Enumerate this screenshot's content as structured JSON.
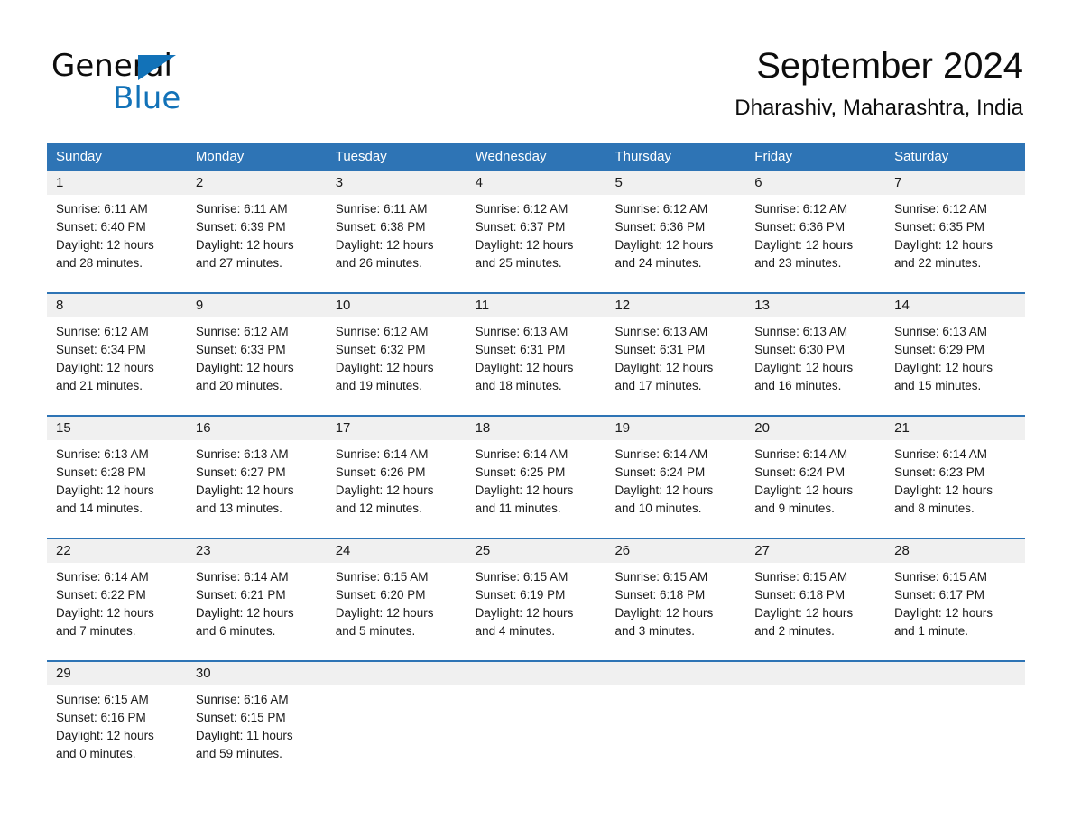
{
  "brand": {
    "name_part1": "General",
    "name_part2": "Blue",
    "triangle_icon": "triangle-logo-icon",
    "accent_color": "#1272b8"
  },
  "header": {
    "month_title": "September 2024",
    "location": "Dharashiv, Maharashtra, India"
  },
  "theme": {
    "header_blue": "#2e74b5",
    "daynum_band": "#f0f0f0",
    "text": "#1a1a1a"
  },
  "calendar": {
    "weekdays": [
      "Sunday",
      "Monday",
      "Tuesday",
      "Wednesday",
      "Thursday",
      "Friday",
      "Saturday"
    ],
    "weeks": [
      {
        "days": [
          {
            "num": "1",
            "sunrise": "Sunrise: 6:11 AM",
            "sunset": "Sunset: 6:40 PM",
            "daylight_line1": "Daylight: 12 hours",
            "daylight_line2": "and 28 minutes."
          },
          {
            "num": "2",
            "sunrise": "Sunrise: 6:11 AM",
            "sunset": "Sunset: 6:39 PM",
            "daylight_line1": "Daylight: 12 hours",
            "daylight_line2": "and 27 minutes."
          },
          {
            "num": "3",
            "sunrise": "Sunrise: 6:11 AM",
            "sunset": "Sunset: 6:38 PM",
            "daylight_line1": "Daylight: 12 hours",
            "daylight_line2": "and 26 minutes."
          },
          {
            "num": "4",
            "sunrise": "Sunrise: 6:12 AM",
            "sunset": "Sunset: 6:37 PM",
            "daylight_line1": "Daylight: 12 hours",
            "daylight_line2": "and 25 minutes."
          },
          {
            "num": "5",
            "sunrise": "Sunrise: 6:12 AM",
            "sunset": "Sunset: 6:36 PM",
            "daylight_line1": "Daylight: 12 hours",
            "daylight_line2": "and 24 minutes."
          },
          {
            "num": "6",
            "sunrise": "Sunrise: 6:12 AM",
            "sunset": "Sunset: 6:36 PM",
            "daylight_line1": "Daylight: 12 hours",
            "daylight_line2": "and 23 minutes."
          },
          {
            "num": "7",
            "sunrise": "Sunrise: 6:12 AM",
            "sunset": "Sunset: 6:35 PM",
            "daylight_line1": "Daylight: 12 hours",
            "daylight_line2": "and 22 minutes."
          }
        ]
      },
      {
        "days": [
          {
            "num": "8",
            "sunrise": "Sunrise: 6:12 AM",
            "sunset": "Sunset: 6:34 PM",
            "daylight_line1": "Daylight: 12 hours",
            "daylight_line2": "and 21 minutes."
          },
          {
            "num": "9",
            "sunrise": "Sunrise: 6:12 AM",
            "sunset": "Sunset: 6:33 PM",
            "daylight_line1": "Daylight: 12 hours",
            "daylight_line2": "and 20 minutes."
          },
          {
            "num": "10",
            "sunrise": "Sunrise: 6:12 AM",
            "sunset": "Sunset: 6:32 PM",
            "daylight_line1": "Daylight: 12 hours",
            "daylight_line2": "and 19 minutes."
          },
          {
            "num": "11",
            "sunrise": "Sunrise: 6:13 AM",
            "sunset": "Sunset: 6:31 PM",
            "daylight_line1": "Daylight: 12 hours",
            "daylight_line2": "and 18 minutes."
          },
          {
            "num": "12",
            "sunrise": "Sunrise: 6:13 AM",
            "sunset": "Sunset: 6:31 PM",
            "daylight_line1": "Daylight: 12 hours",
            "daylight_line2": "and 17 minutes."
          },
          {
            "num": "13",
            "sunrise": "Sunrise: 6:13 AM",
            "sunset": "Sunset: 6:30 PM",
            "daylight_line1": "Daylight: 12 hours",
            "daylight_line2": "and 16 minutes."
          },
          {
            "num": "14",
            "sunrise": "Sunrise: 6:13 AM",
            "sunset": "Sunset: 6:29 PM",
            "daylight_line1": "Daylight: 12 hours",
            "daylight_line2": "and 15 minutes."
          }
        ]
      },
      {
        "days": [
          {
            "num": "15",
            "sunrise": "Sunrise: 6:13 AM",
            "sunset": "Sunset: 6:28 PM",
            "daylight_line1": "Daylight: 12 hours",
            "daylight_line2": "and 14 minutes."
          },
          {
            "num": "16",
            "sunrise": "Sunrise: 6:13 AM",
            "sunset": "Sunset: 6:27 PM",
            "daylight_line1": "Daylight: 12 hours",
            "daylight_line2": "and 13 minutes."
          },
          {
            "num": "17",
            "sunrise": "Sunrise: 6:14 AM",
            "sunset": "Sunset: 6:26 PM",
            "daylight_line1": "Daylight: 12 hours",
            "daylight_line2": "and 12 minutes."
          },
          {
            "num": "18",
            "sunrise": "Sunrise: 6:14 AM",
            "sunset": "Sunset: 6:25 PM",
            "daylight_line1": "Daylight: 12 hours",
            "daylight_line2": "and 11 minutes."
          },
          {
            "num": "19",
            "sunrise": "Sunrise: 6:14 AM",
            "sunset": "Sunset: 6:24 PM",
            "daylight_line1": "Daylight: 12 hours",
            "daylight_line2": "and 10 minutes."
          },
          {
            "num": "20",
            "sunrise": "Sunrise: 6:14 AM",
            "sunset": "Sunset: 6:24 PM",
            "daylight_line1": "Daylight: 12 hours",
            "daylight_line2": "and 9 minutes."
          },
          {
            "num": "21",
            "sunrise": "Sunrise: 6:14 AM",
            "sunset": "Sunset: 6:23 PM",
            "daylight_line1": "Daylight: 12 hours",
            "daylight_line2": "and 8 minutes."
          }
        ]
      },
      {
        "days": [
          {
            "num": "22",
            "sunrise": "Sunrise: 6:14 AM",
            "sunset": "Sunset: 6:22 PM",
            "daylight_line1": "Daylight: 12 hours",
            "daylight_line2": "and 7 minutes."
          },
          {
            "num": "23",
            "sunrise": "Sunrise: 6:14 AM",
            "sunset": "Sunset: 6:21 PM",
            "daylight_line1": "Daylight: 12 hours",
            "daylight_line2": "and 6 minutes."
          },
          {
            "num": "24",
            "sunrise": "Sunrise: 6:15 AM",
            "sunset": "Sunset: 6:20 PM",
            "daylight_line1": "Daylight: 12 hours",
            "daylight_line2": "and 5 minutes."
          },
          {
            "num": "25",
            "sunrise": "Sunrise: 6:15 AM",
            "sunset": "Sunset: 6:19 PM",
            "daylight_line1": "Daylight: 12 hours",
            "daylight_line2": "and 4 minutes."
          },
          {
            "num": "26",
            "sunrise": "Sunrise: 6:15 AM",
            "sunset": "Sunset: 6:18 PM",
            "daylight_line1": "Daylight: 12 hours",
            "daylight_line2": "and 3 minutes."
          },
          {
            "num": "27",
            "sunrise": "Sunrise: 6:15 AM",
            "sunset": "Sunset: 6:18 PM",
            "daylight_line1": "Daylight: 12 hours",
            "daylight_line2": "and 2 minutes."
          },
          {
            "num": "28",
            "sunrise": "Sunrise: 6:15 AM",
            "sunset": "Sunset: 6:17 PM",
            "daylight_line1": "Daylight: 12 hours",
            "daylight_line2": "and 1 minute."
          }
        ]
      },
      {
        "days": [
          {
            "num": "29",
            "sunrise": "Sunrise: 6:15 AM",
            "sunset": "Sunset: 6:16 PM",
            "daylight_line1": "Daylight: 12 hours",
            "daylight_line2": "and 0 minutes."
          },
          {
            "num": "30",
            "sunrise": "Sunrise: 6:16 AM",
            "sunset": "Sunset: 6:15 PM",
            "daylight_line1": "Daylight: 11 hours",
            "daylight_line2": "and 59 minutes."
          },
          {
            "num": "",
            "sunrise": "",
            "sunset": "",
            "daylight_line1": "",
            "daylight_line2": ""
          },
          {
            "num": "",
            "sunrise": "",
            "sunset": "",
            "daylight_line1": "",
            "daylight_line2": ""
          },
          {
            "num": "",
            "sunrise": "",
            "sunset": "",
            "daylight_line1": "",
            "daylight_line2": ""
          },
          {
            "num": "",
            "sunrise": "",
            "sunset": "",
            "daylight_line1": "",
            "daylight_line2": ""
          },
          {
            "num": "",
            "sunrise": "",
            "sunset": "",
            "daylight_line1": "",
            "daylight_line2": ""
          }
        ]
      }
    ]
  }
}
